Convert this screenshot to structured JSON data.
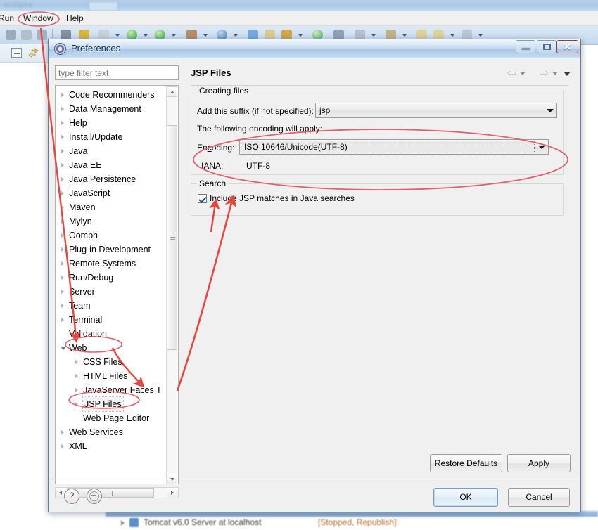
{
  "ide": {
    "menubar": {
      "run": "Run",
      "window": "Window",
      "help": "Help"
    },
    "server_entry": {
      "label": "Tomcat v6.0 Server at localhost",
      "state": "[Stopped, Republish]"
    }
  },
  "dialog": {
    "title": "Preferences",
    "window_controls": {
      "minimize": "",
      "maximize": "",
      "close": "✕"
    },
    "filter": {
      "placeholder": "type filter text",
      "value": ""
    },
    "tree": [
      {
        "label": "Code Recommenders",
        "level": 0,
        "expandable": true,
        "expanded": false,
        "selected": false
      },
      {
        "label": "Data Management",
        "level": 0,
        "expandable": true,
        "expanded": false,
        "selected": false
      },
      {
        "label": "Help",
        "level": 0,
        "expandable": true,
        "expanded": false,
        "selected": false
      },
      {
        "label": "Install/Update",
        "level": 0,
        "expandable": true,
        "expanded": false,
        "selected": false
      },
      {
        "label": "Java",
        "level": 0,
        "expandable": true,
        "expanded": false,
        "selected": false
      },
      {
        "label": "Java EE",
        "level": 0,
        "expandable": true,
        "expanded": false,
        "selected": false
      },
      {
        "label": "Java Persistence",
        "level": 0,
        "expandable": true,
        "expanded": false,
        "selected": false
      },
      {
        "label": "JavaScript",
        "level": 0,
        "expandable": true,
        "expanded": false,
        "selected": false
      },
      {
        "label": "Maven",
        "level": 0,
        "expandable": true,
        "expanded": false,
        "selected": false
      },
      {
        "label": "Mylyn",
        "level": 0,
        "expandable": true,
        "expanded": false,
        "selected": false
      },
      {
        "label": "Oomph",
        "level": 0,
        "expandable": true,
        "expanded": false,
        "selected": false
      },
      {
        "label": "Plug-in Development",
        "level": 0,
        "expandable": true,
        "expanded": false,
        "selected": false
      },
      {
        "label": "Remote Systems",
        "level": 0,
        "expandable": true,
        "expanded": false,
        "selected": false
      },
      {
        "label": "Run/Debug",
        "level": 0,
        "expandable": true,
        "expanded": false,
        "selected": false
      },
      {
        "label": "Server",
        "level": 0,
        "expandable": true,
        "expanded": false,
        "selected": false
      },
      {
        "label": "Team",
        "level": 0,
        "expandable": true,
        "expanded": false,
        "selected": false
      },
      {
        "label": "Terminal",
        "level": 0,
        "expandable": true,
        "expanded": false,
        "selected": false
      },
      {
        "label": "Validation",
        "level": 0,
        "expandable": false,
        "expanded": false,
        "selected": false
      },
      {
        "label": "Web",
        "level": 0,
        "expandable": true,
        "expanded": true,
        "selected": false
      },
      {
        "label": "CSS Files",
        "level": 1,
        "expandable": true,
        "expanded": false,
        "selected": false
      },
      {
        "label": "HTML Files",
        "level": 1,
        "expandable": true,
        "expanded": false,
        "selected": false
      },
      {
        "label": "JavaServer Faces T",
        "level": 1,
        "expandable": true,
        "expanded": false,
        "selected": false
      },
      {
        "label": "JSP Files",
        "level": 1,
        "expandable": true,
        "expanded": false,
        "selected": true
      },
      {
        "label": "Web Page Editor",
        "level": 1,
        "expandable": false,
        "expanded": false,
        "selected": false
      },
      {
        "label": "Web Services",
        "level": 0,
        "expandable": true,
        "expanded": false,
        "selected": false
      },
      {
        "label": "XML",
        "level": 0,
        "expandable": true,
        "expanded": false,
        "selected": false
      }
    ],
    "page": {
      "title": "JSP Files",
      "nav": {
        "back": "⇦",
        "forward": "⇨"
      },
      "creating_files": {
        "group_label": "Creating files",
        "suffix_label": "Add this suffix (if not specified):",
        "suffix_value": "jsp",
        "encoding_note": "The following encoding will apply:",
        "encoding_label": "Encoding:",
        "encoding_value": "ISO 10646/Unicode(UTF-8)",
        "iana_label": "IANA:",
        "iana_value": "UTF-8"
      },
      "search": {
        "group_label": "Search",
        "checkbox_label": "Include JSP matches in Java searches",
        "checkbox_checked": true
      }
    },
    "buttons": {
      "restore_defaults": "Restore Defaults",
      "apply": "Apply",
      "ok": "OK",
      "cancel": "Cancel",
      "help": "?"
    }
  },
  "annotation": {
    "color": "#e8453c",
    "ellipse_color": "#e0707a"
  }
}
